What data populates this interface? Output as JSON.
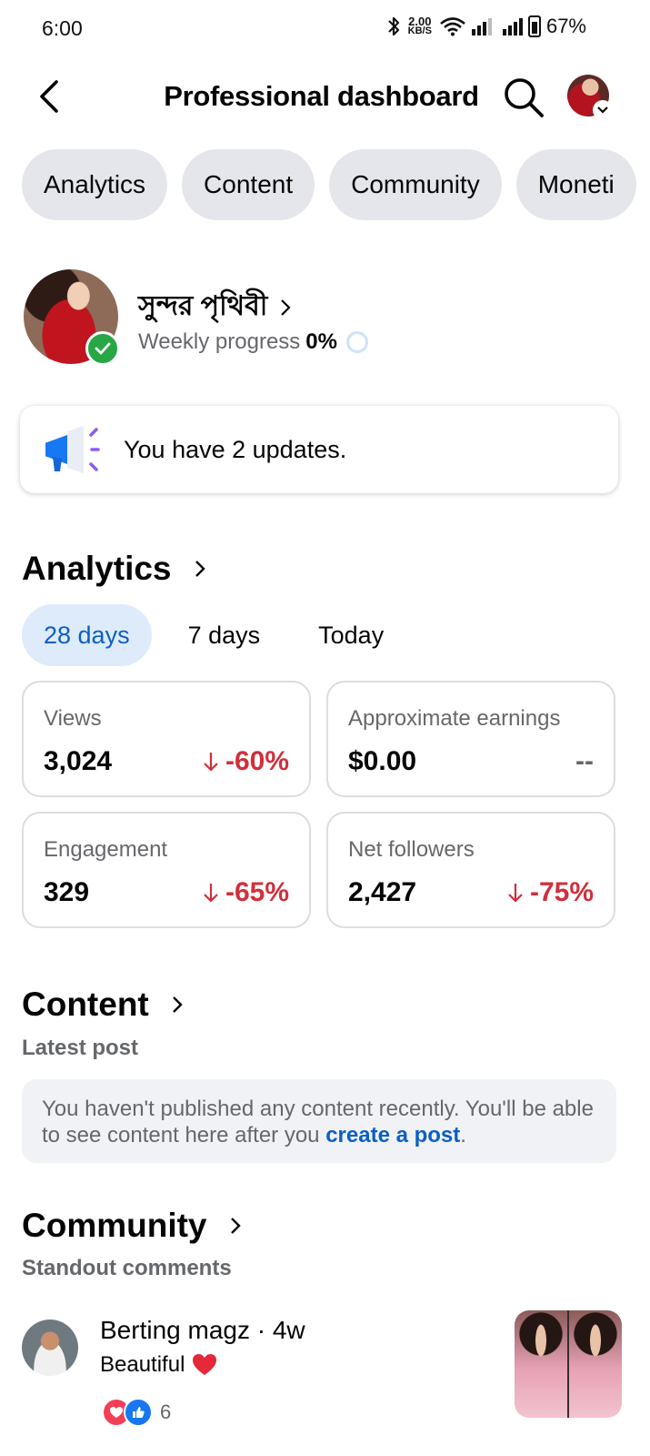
{
  "status_bar": {
    "time": "6:00",
    "net_speed_value": "2.00",
    "net_speed_unit": "KB/S",
    "battery": "67%"
  },
  "header": {
    "title": "Professional dashboard"
  },
  "chips": [
    "Analytics",
    "Content",
    "Community",
    "Moneti"
  ],
  "profile": {
    "name": "সুন্দর পৃথিবী",
    "progress_label": "Weekly progress",
    "progress_value": "0%"
  },
  "updates": {
    "text": "You have 2 updates."
  },
  "analytics": {
    "title": "Analytics",
    "tabs": [
      "28 days",
      "7 days",
      "Today"
    ],
    "active_tab": "28 days",
    "metrics": [
      {
        "label": "Views",
        "value": "3,024",
        "change": "-60%"
      },
      {
        "label": "Approximate earnings",
        "value": "$0.00",
        "change": "--"
      },
      {
        "label": "Engagement",
        "value": "329",
        "change": "-65%"
      },
      {
        "label": "Net followers",
        "value": "2,427",
        "change": "-75%"
      }
    ]
  },
  "content": {
    "title": "Content",
    "subtitle": "Latest post",
    "notice_text": "You haven't published any content recently. You'll be able to see content here after you",
    "notice_link": "create a post",
    "notice_end": "."
  },
  "community": {
    "title": "Community",
    "subtitle": "Standout comments",
    "comment": {
      "author": "Berting magz",
      "age": "4w",
      "text": "Beautiful",
      "reaction_count": "6"
    }
  },
  "colors": {
    "accent_blue": "#0b5fc4",
    "negative_red": "#d12f3b",
    "chip_bg": "#e4e6eb",
    "verified_green": "#28a745"
  },
  "icons": [
    "bluetooth-icon",
    "wifi-icon",
    "signal-icon",
    "battery-icon",
    "back-arrow-icon",
    "search-icon",
    "chevron-down-icon",
    "verified-check-icon",
    "progress-ring-icon",
    "megaphone-icon",
    "chevron-right-icon",
    "arrow-down-icon",
    "heart-emoji-icon",
    "love-reaction-icon",
    "like-reaction-icon"
  ]
}
